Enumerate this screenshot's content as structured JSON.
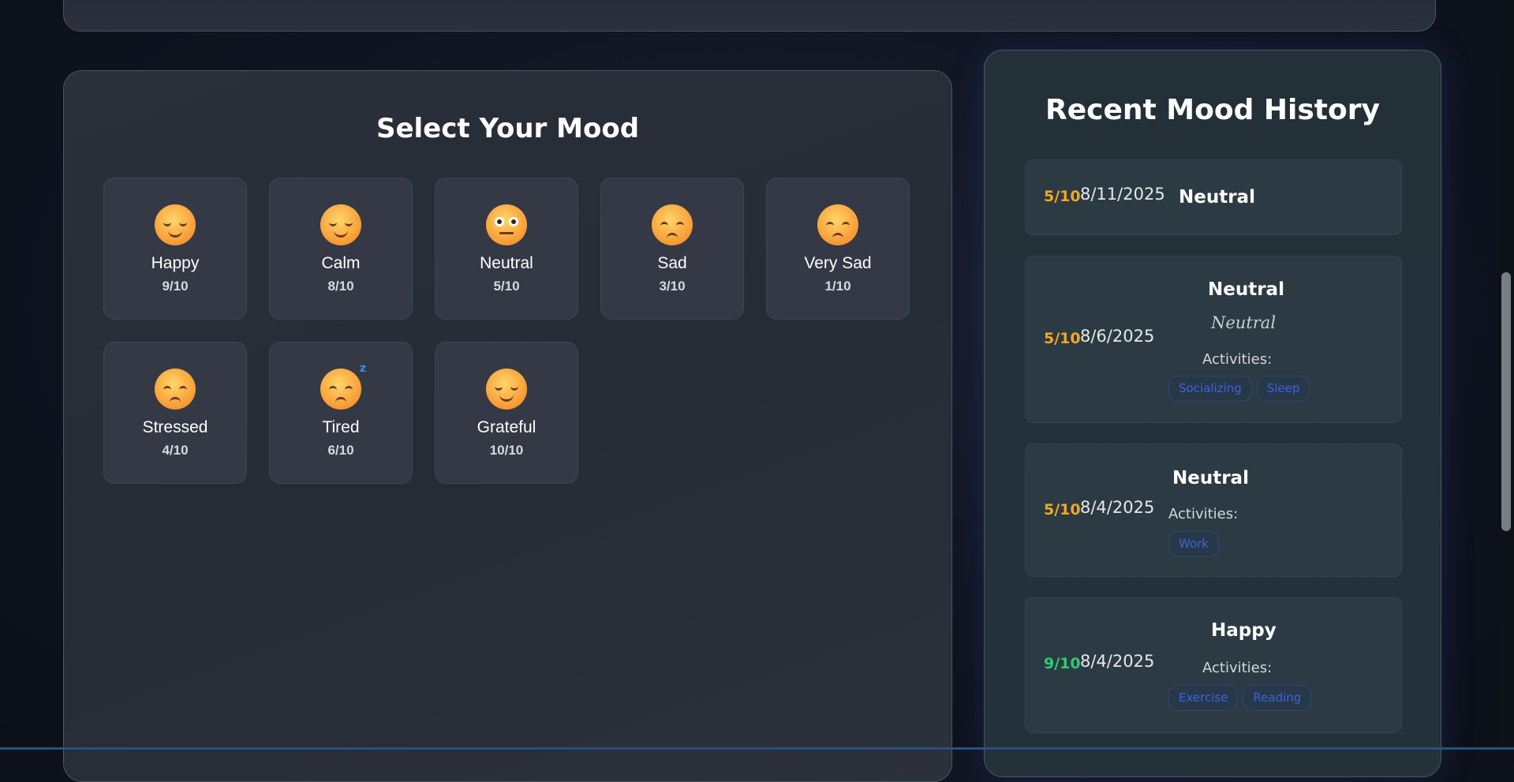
{
  "mood_selector": {
    "title": "Select Your Mood",
    "moods": [
      {
        "name": "Happy",
        "score": "9/10",
        "icon": "smiling-face-icon"
      },
      {
        "name": "Calm",
        "score": "8/10",
        "icon": "relieved-face-icon"
      },
      {
        "name": "Neutral",
        "score": "5/10",
        "icon": "neutral-face-icon"
      },
      {
        "name": "Sad",
        "score": "3/10",
        "icon": "pensive-face-icon"
      },
      {
        "name": "Very Sad",
        "score": "1/10",
        "icon": "pensive-face-icon"
      },
      {
        "name": "Stressed",
        "score": "4/10",
        "icon": "pensive-face-icon"
      },
      {
        "name": "Tired",
        "score": "6/10",
        "icon": "sleeping-face-icon"
      },
      {
        "name": "Grateful",
        "score": "10/10",
        "icon": "smiling-face-icon"
      }
    ]
  },
  "history": {
    "title": "Recent Mood History",
    "activities_label": "Activities:",
    "entries": [
      {
        "score": "5/10",
        "score_color": "#f5a623",
        "date": "8/11/2025",
        "mood": "Neutral",
        "note": "",
        "activities": []
      },
      {
        "score": "5/10",
        "score_color": "#f5a623",
        "date": "8/6/2025",
        "mood": "Neutral",
        "note": "Neutral",
        "activities": [
          "Socializing",
          "Sleep"
        ]
      },
      {
        "score": "5/10",
        "score_color": "#f5a623",
        "date": "8/4/2025",
        "mood": "Neutral",
        "note": "",
        "activities": [
          "Work"
        ]
      },
      {
        "score": "9/10",
        "score_color": "#2ecc71",
        "date": "8/4/2025",
        "mood": "Happy",
        "note": "",
        "activities": [
          "Exercise",
          "Reading"
        ]
      }
    ]
  }
}
